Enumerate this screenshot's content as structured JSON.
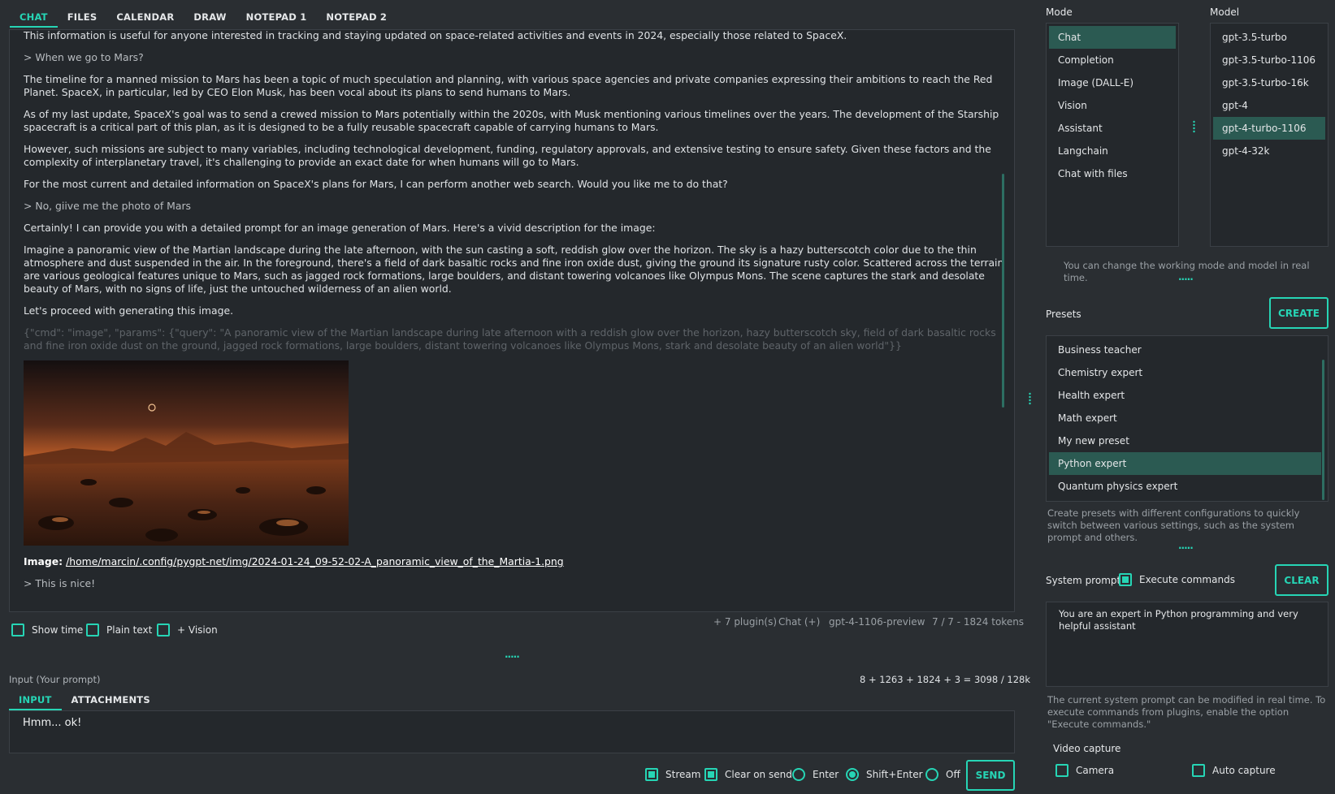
{
  "top_tabs": [
    "CHAT",
    "FILES",
    "CALENDAR",
    "DRAW",
    "NOTEPAD 1",
    "NOTEPAD 2"
  ],
  "chat": {
    "messages": [
      {
        "role": "assistant",
        "text": "This information is useful for anyone interested in tracking and staying updated on space-related activities and events in 2024, especially those related to SpaceX."
      },
      {
        "role": "user",
        "text": "> When we go to Mars?"
      },
      {
        "role": "assistant",
        "text": "The timeline for a manned mission to Mars has been a topic of much speculation and planning, with various space agencies and private companies expressing their ambitions to reach the Red Planet. SpaceX, in particular, led by CEO Elon Musk, has been vocal about its plans to send humans to Mars."
      },
      {
        "role": "assistant",
        "text": "As of my last update, SpaceX's goal was to send a crewed mission to Mars potentially within the 2020s, with Musk mentioning various timelines over the years. The development of the Starship spacecraft is a critical part of this plan, as it is designed to be a fully reusable spacecraft capable of carrying humans to Mars."
      },
      {
        "role": "assistant",
        "text": "However, such missions are subject to many variables, including technological development, funding, regulatory approvals, and extensive testing to ensure safety. Given these factors and the complexity of interplanetary travel, it's challenging to provide an exact date for when humans will go to Mars."
      },
      {
        "role": "assistant",
        "text": "For the most current and detailed information on SpaceX's plans for Mars, I can perform another web search. Would you like me to do that?"
      },
      {
        "role": "user",
        "text": "> No, giive me the photo of Mars"
      },
      {
        "role": "assistant",
        "text": "Certainly! I can provide you with a detailed prompt for an image generation of Mars. Here's a vivid description for the image:"
      },
      {
        "role": "assistant",
        "text": "Imagine a panoramic view of the Martian landscape during the late afternoon, with the sun casting a soft, reddish glow over the horizon. The sky is a hazy butterscotch color due to the thin atmosphere and dust suspended in the air. In the foreground, there's a field of dark basaltic rocks and fine iron oxide dust, giving the ground its signature rusty color. Scattered across the terrain are various geological features unique to Mars, such as jagged rock formations, large boulders, and distant towering volcanoes like Olympus Mons. The scene captures the stark and desolate beauty of Mars, with no signs of life, just the untouched wilderness of an alien world."
      },
      {
        "role": "assistant",
        "text": "Let's proceed with generating this image."
      },
      {
        "role": "cmd",
        "text": "{\"cmd\": \"image\", \"params\": {\"query\": \"A panoramic view of the Martian landscape during late afternoon with a reddish glow over the horizon, hazy butterscotch sky, field of dark basaltic rocks and fine iron oxide dust on the ground, jagged rock formations, large boulders, distant towering volcanoes like Olympus Mons, stark and desolate beauty of an alien world\"}}"
      }
    ],
    "image_label": "Image:",
    "image_path": "/home/marcin/.config/pygpt-net/img/2024-01-24_09-52-02-A_panoramic_view_of_the_Martia-1.png",
    "last_user": "> This is nice!"
  },
  "options": {
    "show_time": "Show time",
    "plain_text": "Plain text",
    "vision": "+ Vision"
  },
  "status": {
    "plugins": "+ 7 plugin(s)",
    "mode": "Chat (+)",
    "model": "gpt-4-1106-preview",
    "tokens": "7 / 7 - 1824 tokens"
  },
  "input": {
    "label": "Input (Your prompt)",
    "counter": "8 + 1263 + 1824 + 3 = 3098 / 128k",
    "tabs": [
      "INPUT",
      "ATTACHMENTS"
    ],
    "value": "Hmm... ok!"
  },
  "bottom": {
    "stream": "Stream",
    "clear_on_send": "Clear on send",
    "enter": "Enter",
    "shift_enter": "Shift+Enter",
    "off": "Off",
    "send": "SEND"
  },
  "right": {
    "mode_label": "Mode",
    "model_label": "Model",
    "modes": [
      "Chat",
      "Completion",
      "Image (DALL-E)",
      "Vision",
      "Assistant",
      "Langchain",
      "Chat with files"
    ],
    "models": [
      "gpt-3.5-turbo",
      "gpt-3.5-turbo-1106",
      "gpt-3.5-turbo-16k",
      "gpt-4",
      "gpt-4-turbo-1106",
      "gpt-4-32k"
    ],
    "mode_hint": "You can change the working mode and model in real time.",
    "presets_label": "Presets",
    "create": "CREATE",
    "presets": [
      "Business teacher",
      "Chemistry expert",
      "Health expert",
      "Math expert",
      "My new preset",
      "Python expert",
      "Quantum physics expert"
    ],
    "presets_hint": "Create presets with different configurations to quickly switch between various settings, such as the system prompt and others.",
    "system_prompt_label": "System prompt",
    "execute_commands": "Execute commands",
    "clear": "CLEAR",
    "system_prompt": "You are an expert in Python programming and very helpful assistant",
    "system_hint": "The current system prompt can be modified in real time. To execute commands from plugins, enable the option \"Execute commands.\"",
    "video_label": "Video capture",
    "camera": "Camera",
    "auto_capture": "Auto capture"
  },
  "colors": {
    "accent": "#26d5b5",
    "background": "#2a2e32",
    "panel": "#24282c",
    "selected": "#2b5a52"
  }
}
